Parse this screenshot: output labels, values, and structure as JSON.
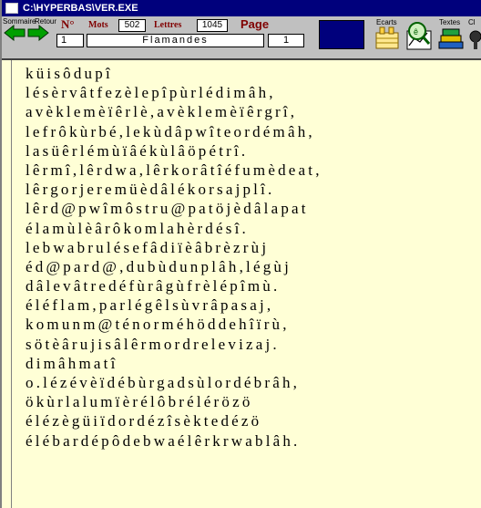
{
  "window": {
    "title": "C:\\HYPERBAS\\VER.EXE"
  },
  "toolbar": {
    "sommaire_label": "Sommaire",
    "retour_label": "Retour",
    "no_label": "N°",
    "mots_label": "Mots",
    "lettres_label": "Lettres",
    "page_label": "Page",
    "ecarts_label": "Ecarts",
    "textes_label": "Textes",
    "cl_label": "Cl",
    "mots_value": "502",
    "lettres_value": "1045",
    "no_value": "1",
    "title_value": "Flamandes",
    "page_value": "1"
  },
  "content": {
    "lines": [
      "küisôdupî",
      "lésèrvâtfezèlepîpùrlédimâh,",
      "avèklemèïêrlè,avèklemèïêrgrî,",
      "lefrôkùrbé,lekùdâpwîteordémâh,",
      "lasüêrlémùïâékùlâöpétrî.",
      "lêrmî,lêrdwa,lêrkorâtîéfumèdeat,",
      "lêrgorjeremüèdâlékorsajplî.",
      "lêrd@pwîmôstru@patöjèdâlapat",
      "élamùlèârôkomlahèrdésî.",
      "lebwabrulésefâdiïèâbrèzrùj",
      "éd@pard@,dubùdunplâh,légùj",
      "dâlevâtredéfùrâgùfrèlépîmù.",
      "éléflam,parlégêlsùvrâpasaj,",
      "komunm@ténorméhöddehîïrù,",
      "sötèârujisâlêrmordrelevizaj.",
      "dimâhmatî",
      "o.lézévèïdébùrgadsùlordébrâh,",
      "ökùrlalumïèrélôbrélérözö",
      "élézègüiïdordézîsèktedézö",
      "élébardépôdebwaélêrkrwablâh."
    ]
  },
  "colors": {
    "titlebar": "#00007c",
    "toolbar": "#c0c0c0",
    "content_bg": "#ffffd6",
    "field_label": "#800000",
    "arrow": "#00a000"
  }
}
